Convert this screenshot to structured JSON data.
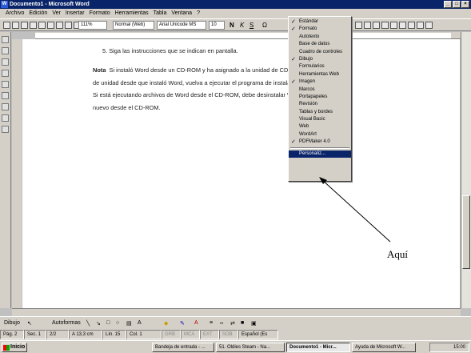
{
  "window": {
    "title": "Documento1 - Microsoft Word"
  },
  "menu": [
    "Archivo",
    "Edición",
    "Ver",
    "Insertar",
    "Formato",
    "Herramientas",
    "Tabla",
    "Ventana",
    "?"
  ],
  "toolbar": {
    "zoom": "111%",
    "style": "Normal (Web)",
    "font": "Arial Unicode MS",
    "size": "10"
  },
  "document": {
    "step5": "5.    Siga las instrucciones que se indican en pantalla.",
    "note_label": "Nota",
    "note_line1": "Si instaló Word desde un CD-ROM y ha asignado a la unidad de CD-ROM una nueva letra",
    "note_line2": "de unidad desde que instaló Word, vuelva a ejecutar el programa de instalación desde el CD-ROM.",
    "note_line3": "Si está ejecutando archivos de Word desde el CD-ROM, debe desinstalar Word e instalarlo de",
    "note_line4": "nuevo desde el CD-ROM."
  },
  "toolbars_menu": [
    {
      "label": "Estándar",
      "checked": true
    },
    {
      "label": "Formato",
      "checked": true
    },
    {
      "label": "Autotexto",
      "checked": false
    },
    {
      "label": "Base de datos",
      "checked": false
    },
    {
      "label": "Cuadro de controles",
      "checked": false
    },
    {
      "label": "Dibujo",
      "checked": true
    },
    {
      "label": "Formularios",
      "checked": false
    },
    {
      "label": "Herramientas Web",
      "checked": false
    },
    {
      "label": "Imagen",
      "checked": true
    },
    {
      "label": "Marcos",
      "checked": false
    },
    {
      "label": "Portapapeles",
      "checked": false
    },
    {
      "label": "Revisión",
      "checked": false
    },
    {
      "label": "Tablas y bordes",
      "checked": false
    },
    {
      "label": "Visual Basic",
      "checked": false
    },
    {
      "label": "Web",
      "checked": false
    },
    {
      "label": "WordArt",
      "checked": false
    },
    {
      "label": "PDFMaker 4.0",
      "checked": true
    }
  ],
  "toolbars_menu_customize": "Personaliz...",
  "annotation": "Aquí",
  "drawbar": {
    "draw": "Dibujo",
    "autoshapes": "Autoformas"
  },
  "status": [
    "Pág. 2",
    "Sec. 1",
    "2/2",
    "A 13,3 cm",
    "Lín. 15",
    "Col. 1",
    "GRB",
    "MCA",
    "EXT",
    "SOB",
    "Español (Es"
  ],
  "taskbar": {
    "start": "Inicio",
    "tasks": [
      "Bandeja de entrada - ...",
      "51. Oldies Steam - Na...",
      "Documento1 - Micr...",
      "Ayuda de Microsoft W..."
    ],
    "clock": "15:00"
  },
  "colors": {
    "title_bg": "#0a246a",
    "face": "#d4d0c8",
    "highlight": "#0a246a"
  }
}
